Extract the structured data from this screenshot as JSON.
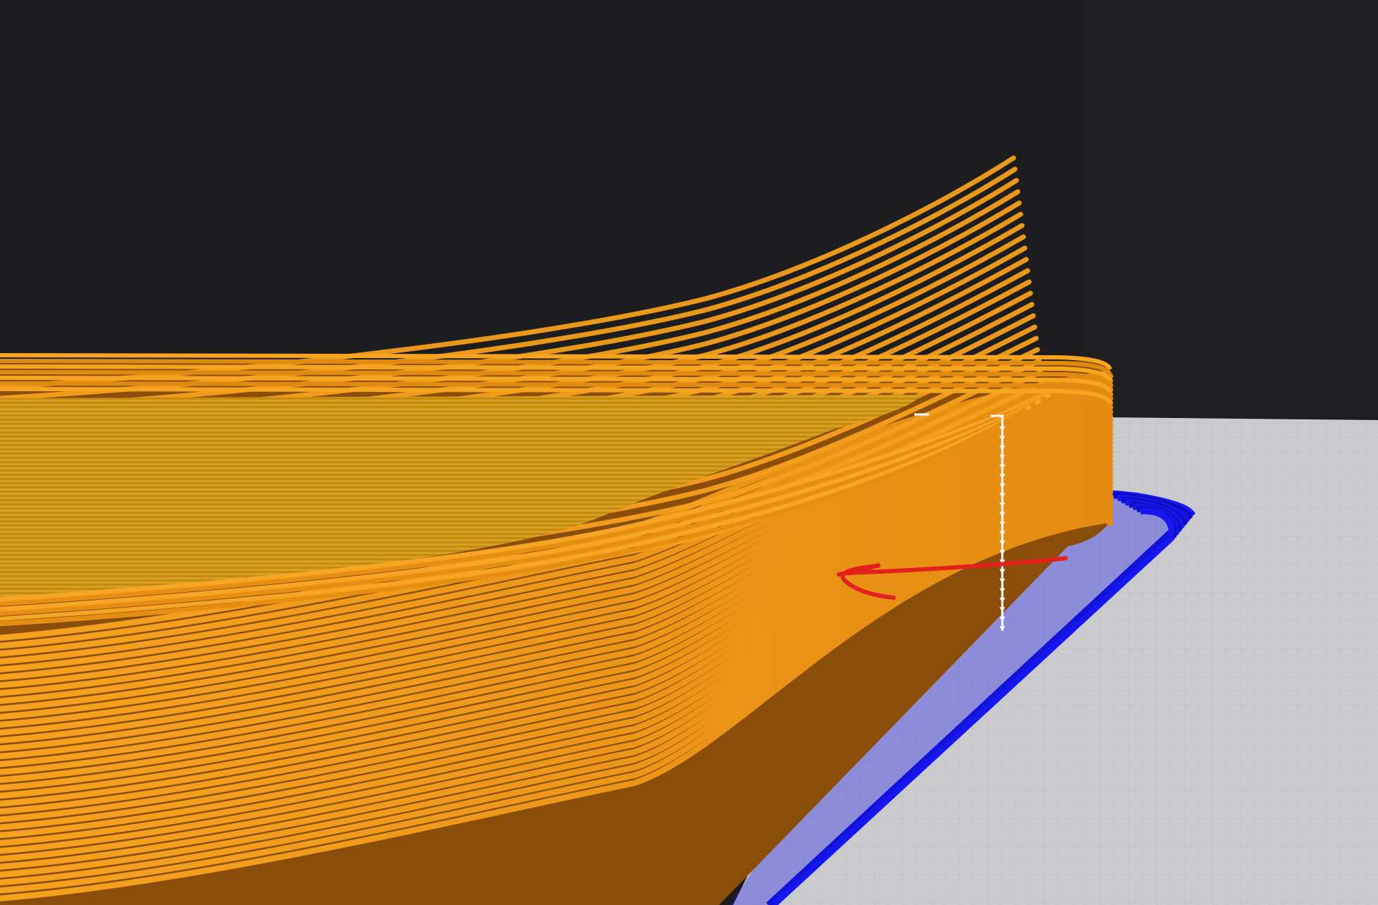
{
  "colors": {
    "background": "#1d1d20",
    "build_plate": "#c8c8ca",
    "wall": "#f29b1d",
    "wall_shadow": "#8a4e0a",
    "top_surface": "#d39a1a",
    "skirt": "#1616ee",
    "seam_marker": "#ffffff",
    "annotation": "#e3201b"
  },
  "icons": {
    "seam_markers": "layer-seam-marker-icon",
    "annotation": "hand-drawn-arrow-icon"
  }
}
